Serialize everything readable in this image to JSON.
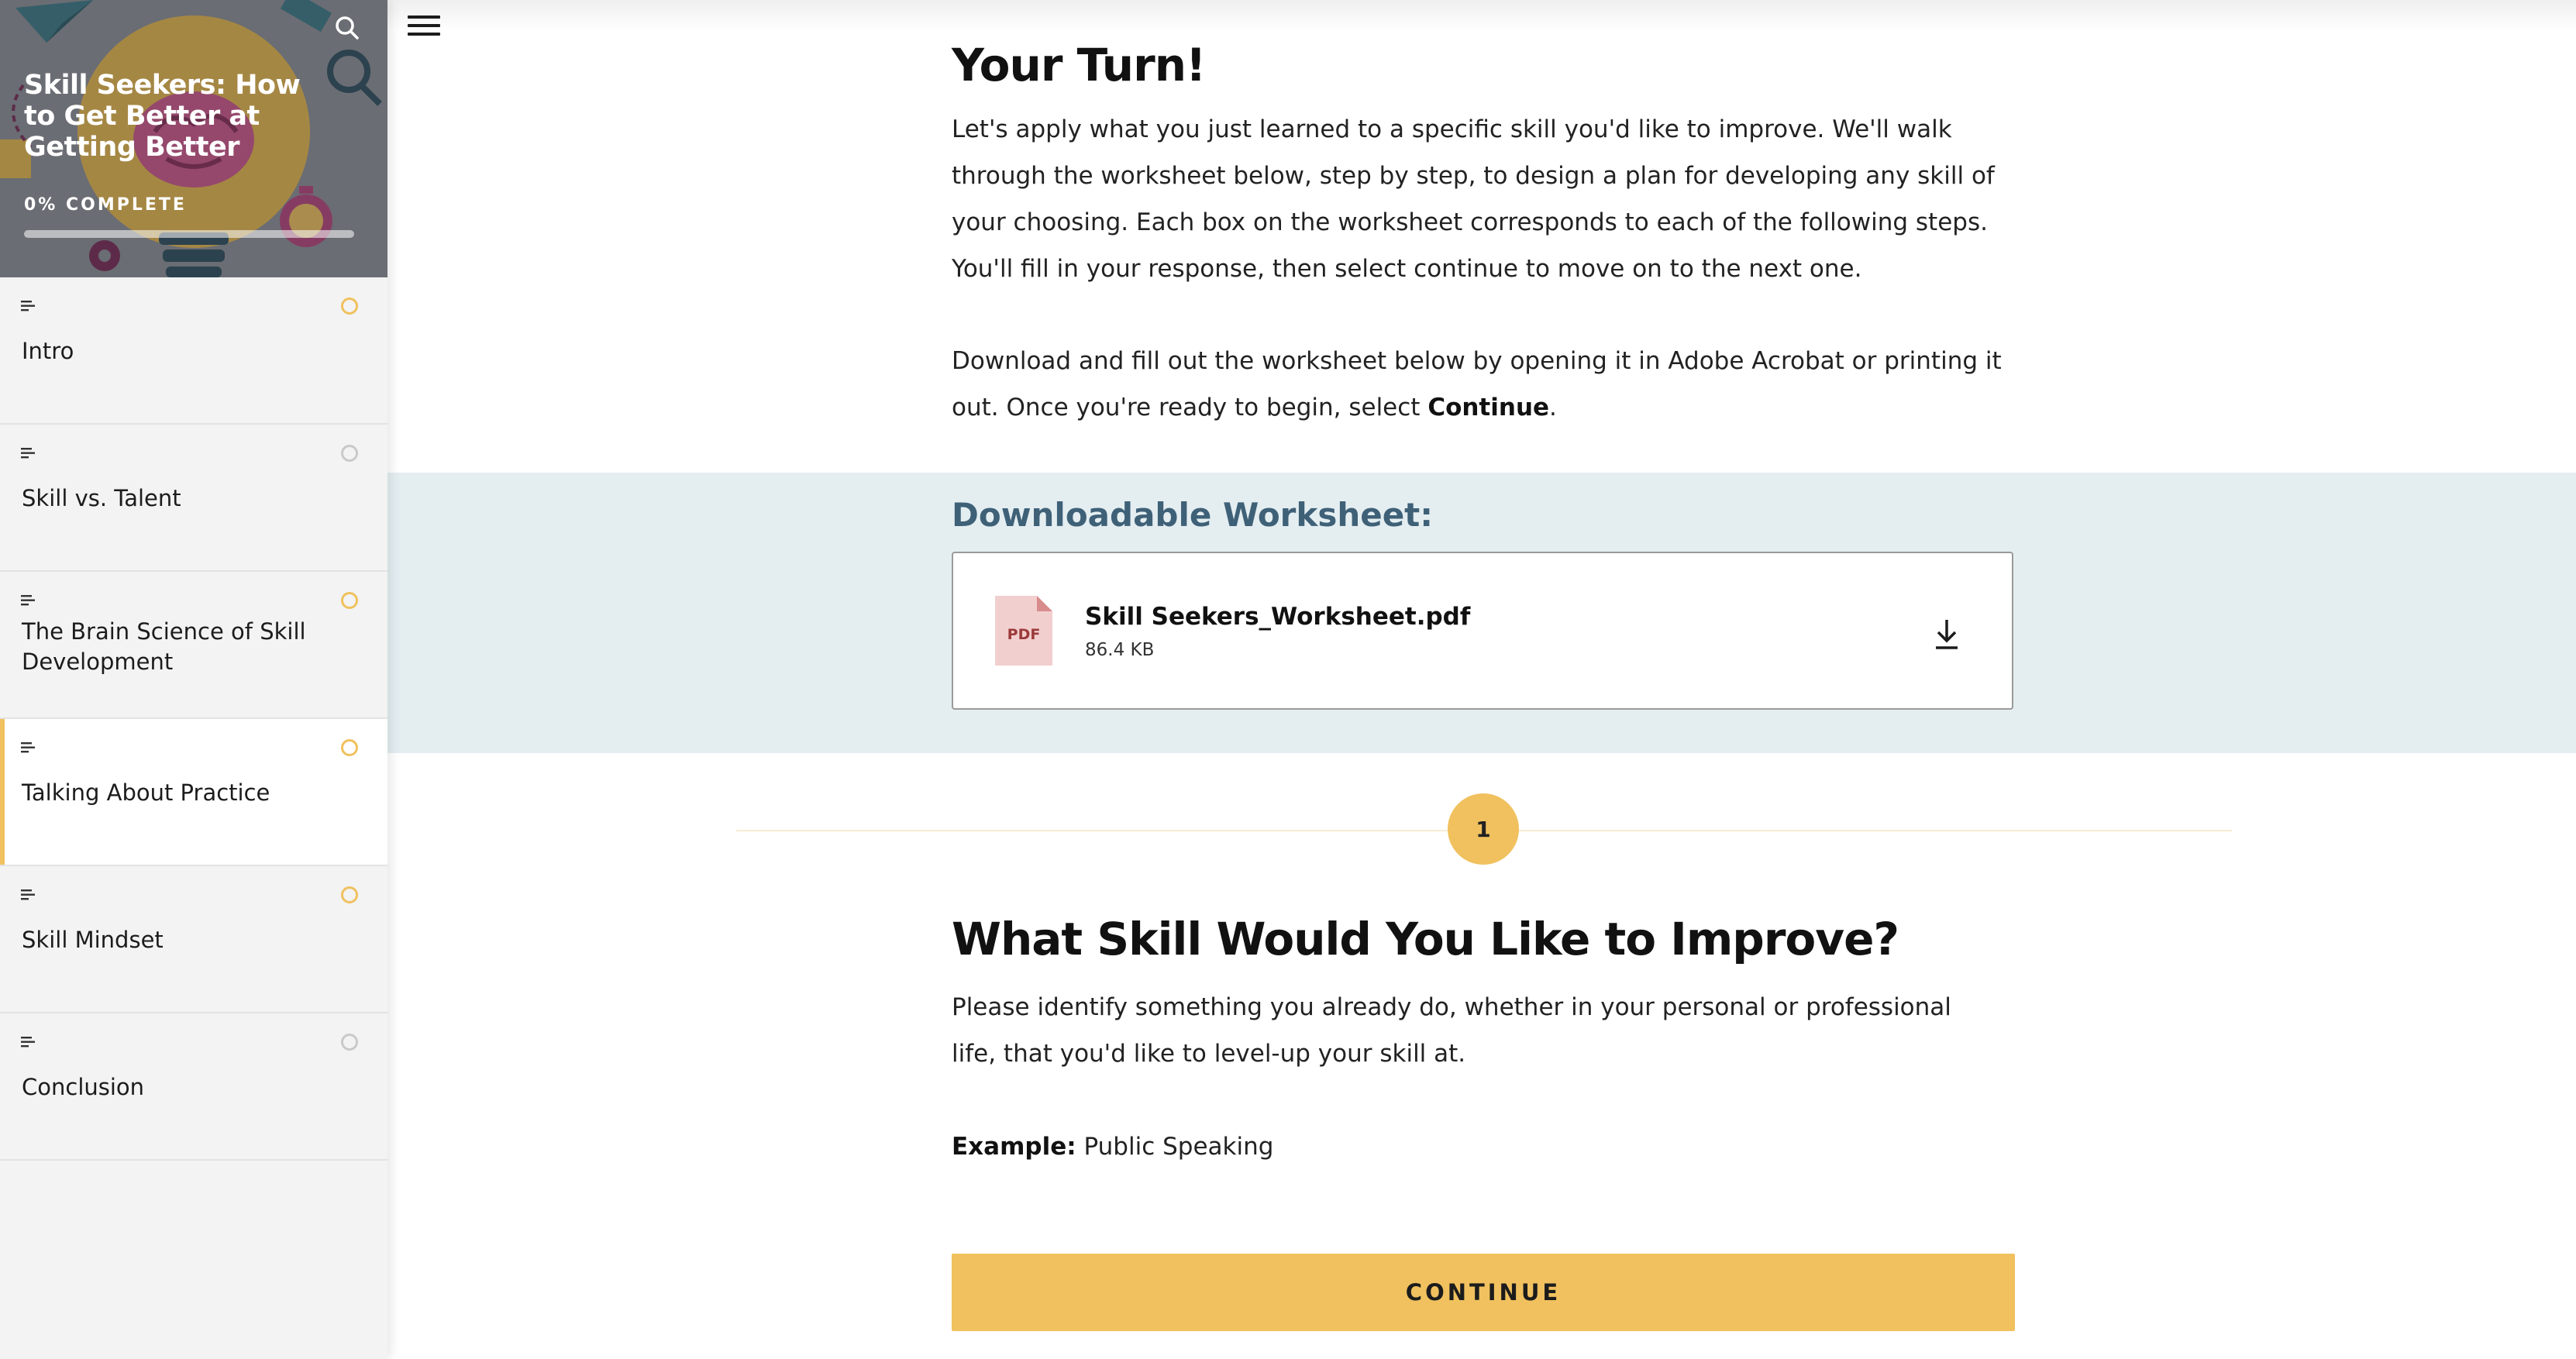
{
  "sidebar": {
    "course_title": "Skill Seekers: How to Get Better at Getting Better",
    "progress_label": "0% COMPLETE",
    "progress_fraction": 0,
    "lessons": [
      {
        "label": "Intro",
        "status": "in-progress"
      },
      {
        "label": "Skill vs. Talent",
        "status": "not-started"
      },
      {
        "label": "The Brain Science of Skill Development",
        "status": "in-progress"
      },
      {
        "label": "Talking About Practice",
        "status": "in-progress",
        "active": true
      },
      {
        "label": "Skill Mindset",
        "status": "in-progress"
      },
      {
        "label": "Conclusion",
        "status": "not-started"
      }
    ]
  },
  "icons": {
    "search": "search-icon",
    "menu": "hamburger-menu-icon",
    "lesson_type": "text-lines-icon",
    "status": "status-circle-icon",
    "pdf": "pdf-file-icon",
    "download": "download-icon"
  },
  "colors": {
    "accent": "#f0c15e",
    "band": "#e4eef1",
    "band_title": "#3f6178"
  },
  "content": {
    "heading": "Your Turn!",
    "intro": "Let's apply what you just learned to a specific skill you'd like to improve. We'll walk through the worksheet below, step by step, to design a plan for developing any skill of your choosing. Each box on the worksheet corresponds to each of the following steps. You'll fill in your response, then select continue to move on to the next one.",
    "download_text": "Download and fill out the worksheet below by opening it in Adobe Acrobat or printing it out. Once you're ready to begin, select ",
    "download_text_bold": "Continue",
    "download_text_end": ".",
    "worksheet": {
      "title": "Downloadable Worksheet:",
      "file_name": "Skill Seekers_Worksheet.pdf",
      "file_size": "86.4 KB",
      "file_type": "PDF"
    },
    "step": {
      "number": "1",
      "heading": "What Skill Would You Like to Improve?",
      "body": "Please identify something you already do, whether in your personal or professional life, that you'd like to level-up your skill at.",
      "example_label": "Example:",
      "example_value": " Public Speaking"
    },
    "continue_label": "CONTINUE"
  }
}
